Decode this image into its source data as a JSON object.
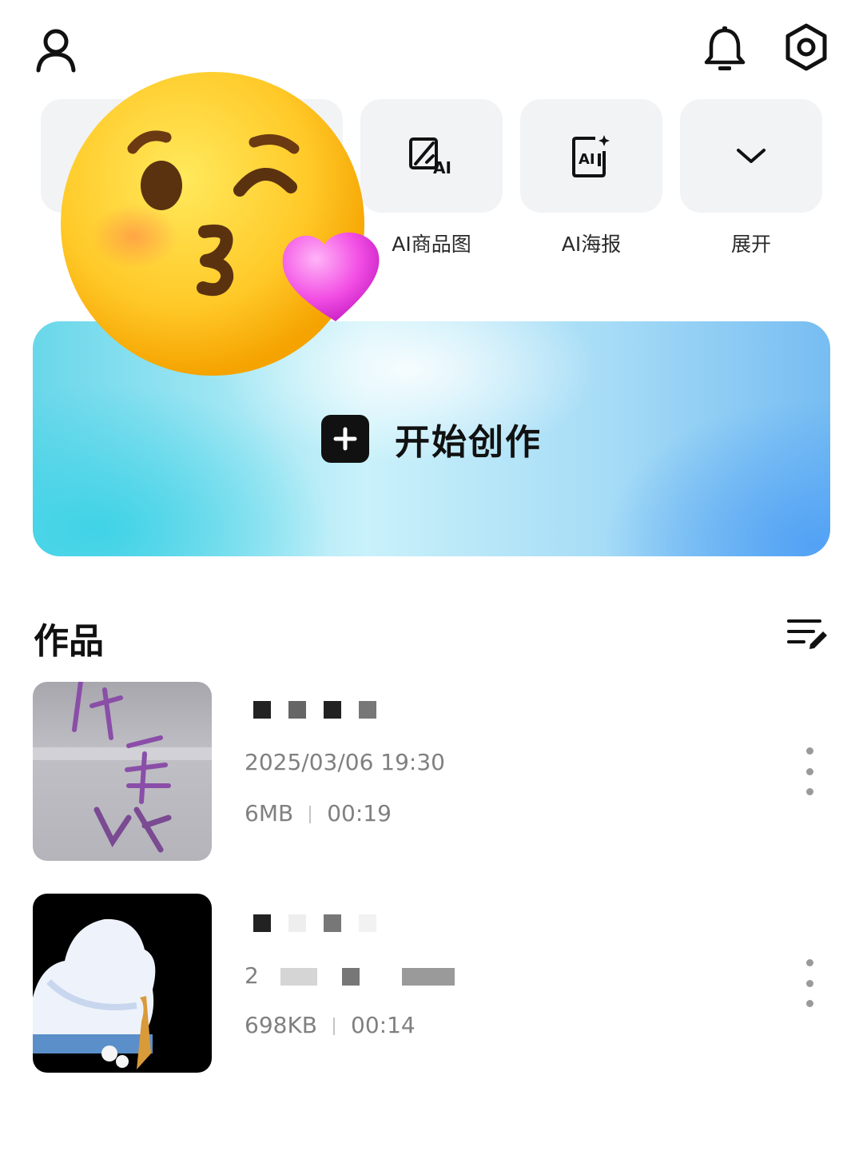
{
  "topbar": {
    "profile_icon": "person-icon",
    "bell_icon": "bell-icon",
    "settings_icon": "hexagon-settings-icon"
  },
  "tools": [
    {
      "label": "AI商品图",
      "icon": "ai-image-edit-icon"
    },
    {
      "label": "AI海报",
      "icon": "ai-poster-icon"
    },
    {
      "label": "展开",
      "icon": "chevron-down-icon"
    }
  ],
  "banner": {
    "label": "开始创作",
    "icon": "plus-icon"
  },
  "works": {
    "title": "作品",
    "edit_icon": "list-edit-icon",
    "items": [
      {
        "date": "2025/03/06 19:30",
        "size": "6MB",
        "duration": "00:19"
      },
      {
        "date": "2",
        "size": "698KB",
        "duration": "00:14"
      }
    ]
  },
  "colors": {
    "banner_start": "#69d7ea",
    "banner_end": "#77bdf2",
    "tile_bg": "#f2f3f5",
    "meta_text": "#808080"
  }
}
